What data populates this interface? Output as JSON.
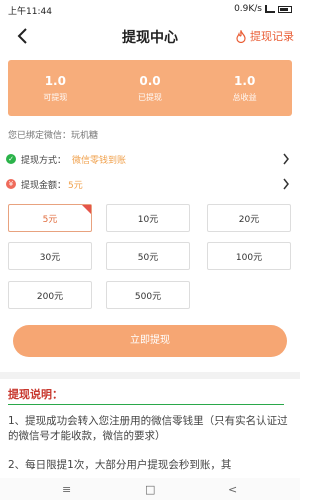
{
  "status_bar": {
    "time": "上午11:44",
    "network": "0.9K/s"
  },
  "header": {
    "title": "提现中心",
    "records_label": "提现记录"
  },
  "stats": [
    {
      "value": "1.0",
      "label": "可提现"
    },
    {
      "value": "0.0",
      "label": "已提现"
    },
    {
      "value": "1.0",
      "label": "总收益"
    }
  ],
  "bound_wechat": "您已绑定微信：玩机糖",
  "method": {
    "label": "提现方式：",
    "value": "微信零钱到账"
  },
  "amount": {
    "label": "提现金额：",
    "value": "5元"
  },
  "amount_options": [
    "5元",
    "10元",
    "20元",
    "30元",
    "50元",
    "100元",
    "200元",
    "500元"
  ],
  "selected_amount_index": 0,
  "withdraw_button": "立即提现",
  "explain": {
    "title": "提现说明：",
    "notes": [
      "1、提现成功会转入您注册用的微信零钱里（只有实名认证过的微信号才能收款，微信的要求）",
      "2、每日限提1次，大部分用户提现会秒到账，其"
    ]
  },
  "system_nav": {
    "menu": "≡",
    "home": "□",
    "back": "<"
  }
}
